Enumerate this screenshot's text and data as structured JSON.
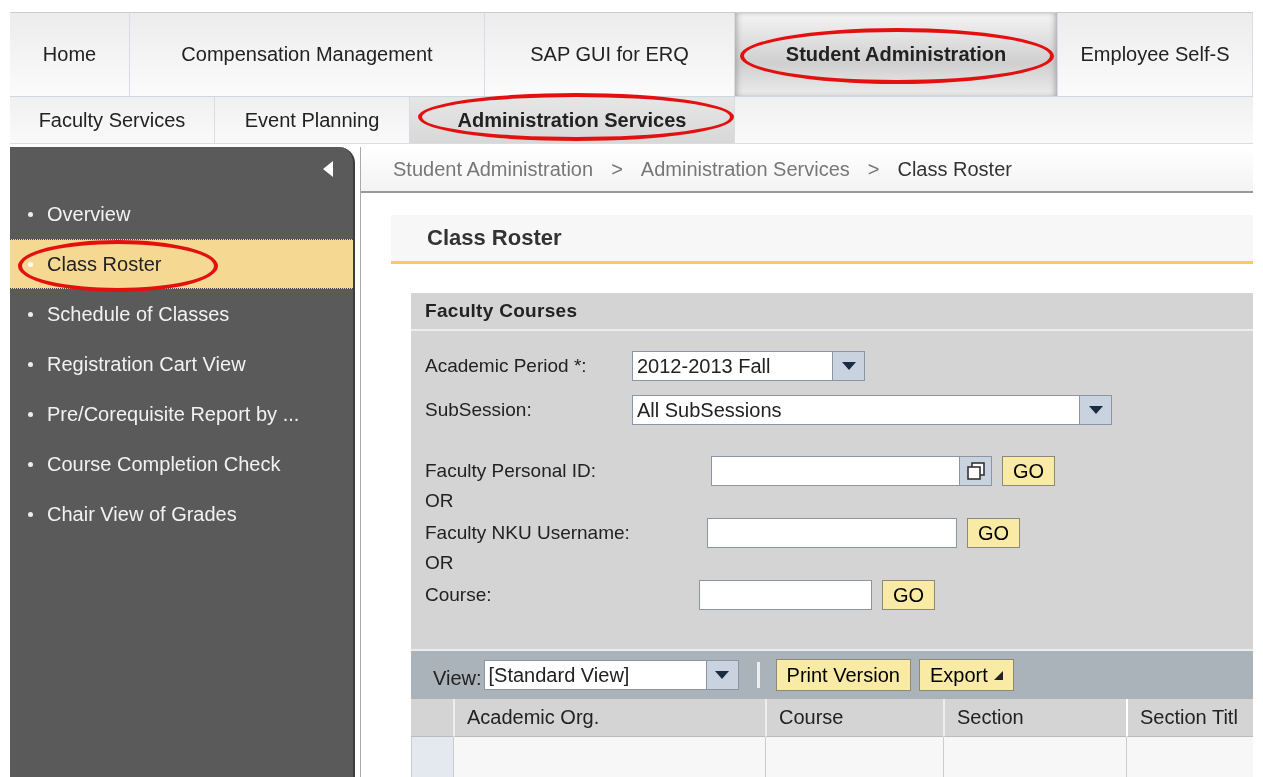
{
  "top_tabs": [
    {
      "label": "Home",
      "selected": false,
      "circled": false
    },
    {
      "label": "Compensation Management",
      "selected": false,
      "circled": false
    },
    {
      "label": "SAP GUI for ERQ",
      "selected": false,
      "circled": false
    },
    {
      "label": "Student Administration",
      "selected": true,
      "circled": true
    },
    {
      "label": "Employee Self-S",
      "selected": false,
      "circled": false
    }
  ],
  "sub_tabs": [
    {
      "label": "Faculty Services",
      "selected": false,
      "circled": false
    },
    {
      "label": "Event Planning",
      "selected": false,
      "circled": false
    },
    {
      "label": "Administration Services",
      "selected": true,
      "circled": true
    }
  ],
  "sidebar": {
    "items": [
      {
        "label": "Overview",
        "selected": false,
        "circled": false
      },
      {
        "label": "Class Roster",
        "selected": true,
        "circled": true
      },
      {
        "label": "Schedule of Classes",
        "selected": false,
        "circled": false
      },
      {
        "label": "Registration Cart View",
        "selected": false,
        "circled": false
      },
      {
        "label": "Pre/Corequisite Report by ...",
        "selected": false,
        "circled": false
      },
      {
        "label": "Course Completion Check",
        "selected": false,
        "circled": false
      },
      {
        "label": "Chair View of Grades",
        "selected": false,
        "circled": false
      }
    ]
  },
  "breadcrumb": [
    {
      "kind": "link",
      "label": "Student Administration"
    },
    {
      "kind": "separator",
      "label": ">"
    },
    {
      "kind": "link",
      "label": "Administration Services"
    },
    {
      "kind": "separator",
      "label": ">"
    },
    {
      "kind": "current",
      "label": "Class Roster"
    }
  ],
  "page_title": "Class Roster",
  "panel": {
    "title": "Faculty Courses",
    "fields": [
      {
        "kind": "select",
        "label": "Academic Period *:",
        "value": "2012-2013 Fall"
      },
      {
        "kind": "select",
        "label": "SubSession:",
        "value": "All SubSessions"
      },
      {
        "kind": "lookup",
        "label": "Faculty Personal ID:",
        "button": "GO"
      },
      {
        "kind": "or",
        "label": "OR"
      },
      {
        "kind": "input",
        "label": "Faculty NKU Username:",
        "button": "GO"
      },
      {
        "kind": "or",
        "label": "OR"
      },
      {
        "kind": "input",
        "label": "Course:",
        "button": "GO"
      }
    ]
  },
  "toolbar": {
    "view_label": "View:",
    "view_value": "[Standard View]",
    "buttons": [
      {
        "kind": "plain",
        "label": "Print Version"
      },
      {
        "kind": "menu",
        "label": "Export"
      }
    ]
  },
  "table": {
    "columns": [
      "Academic Org.",
      "Course",
      "Section",
      "Section Titl"
    ]
  }
}
